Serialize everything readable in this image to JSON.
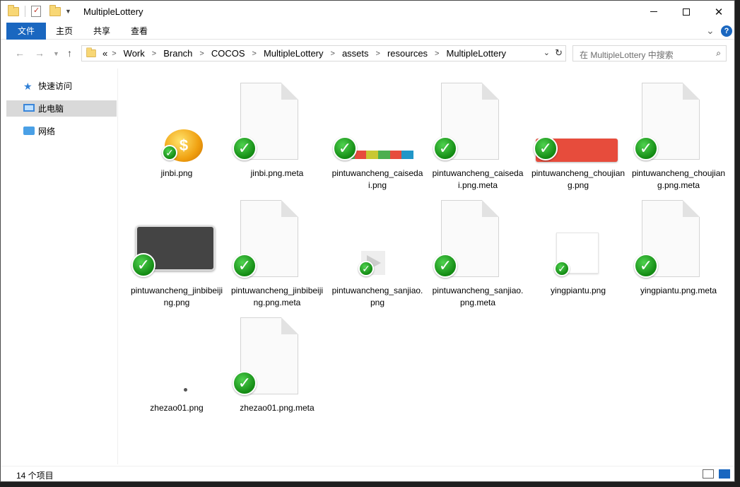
{
  "window": {
    "title": "MultipleLottery"
  },
  "ribbon": {
    "tabs": [
      "文件",
      "主页",
      "共享",
      "查看"
    ]
  },
  "address": {
    "overflow": "«",
    "crumbs": [
      "Work",
      "Branch",
      "COCOS",
      "MultipleLottery",
      "assets",
      "resources",
      "MultipleLottery"
    ]
  },
  "search": {
    "placeholder": "在 MultipleLottery 中搜索"
  },
  "sidebar": {
    "items": [
      {
        "label": "快速访问",
        "icon": "star-icon"
      },
      {
        "label": "此电脑",
        "icon": "computer-icon",
        "selected": true
      },
      {
        "label": "网络",
        "icon": "network-icon"
      }
    ]
  },
  "files": [
    {
      "name": "jinbi.png",
      "kind": "coin-image"
    },
    {
      "name": "jinbi.png.meta",
      "kind": "document"
    },
    {
      "name": "pintuwancheng_caisedai.png",
      "kind": "color-ribbon-image"
    },
    {
      "name": "pintuwancheng_caisedai.png.meta",
      "kind": "document"
    },
    {
      "name": "pintuwancheng_choujiang.png",
      "kind": "red-button-image"
    },
    {
      "name": "pintuwancheng_choujiang.png.meta",
      "kind": "document"
    },
    {
      "name": "pintuwancheng_jinbibeijing.png",
      "kind": "dark-panel-image"
    },
    {
      "name": "pintuwancheng_jinbibeijing.png.meta",
      "kind": "document"
    },
    {
      "name": "pintuwancheng_sanjiao.png",
      "kind": "triangle-image"
    },
    {
      "name": "pintuwancheng_sanjiao.png.meta",
      "kind": "document"
    },
    {
      "name": "yingpiantu.png",
      "kind": "white-image"
    },
    {
      "name": "yingpiantu.png.meta",
      "kind": "document"
    },
    {
      "name": "zhezao01.png",
      "kind": "dot-image"
    },
    {
      "name": "zhezao01.png.meta",
      "kind": "document"
    }
  ],
  "status": {
    "count": "14 个项目"
  },
  "colors": {
    "accent": "#1a67c0",
    "check": "#1f9a1f",
    "ribbon": [
      "#4caf50",
      "#e74c3c",
      "#c8c832",
      "#4caf50",
      "#e74c3c",
      "#2196c8"
    ]
  }
}
